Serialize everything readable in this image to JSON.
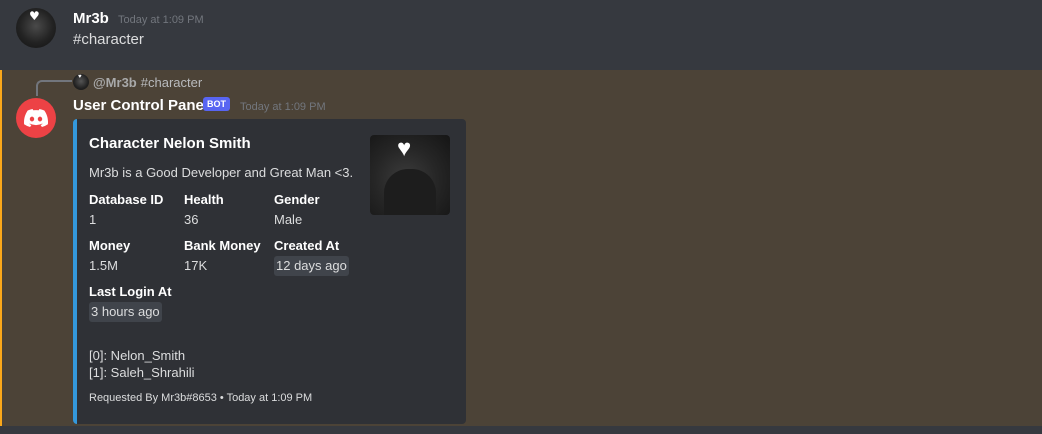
{
  "message1": {
    "username": "Mr3b",
    "timestamp": "Today at 1:09 PM",
    "content": "#character"
  },
  "message2": {
    "reply": {
      "mention": "@Mr3b",
      "content": "#character"
    },
    "username": "User Control Panel",
    "bot_badge": "BOT",
    "timestamp": "Today at 1:09 PM",
    "embed": {
      "accent_color": "#3498db",
      "title": "Character Nelon Smith",
      "description": "Mr3b is a Good Developer and Great Man <3.",
      "fields": [
        {
          "name": "Database ID",
          "value": "1"
        },
        {
          "name": "Health",
          "value": "36"
        },
        {
          "name": "Gender",
          "value": "Male"
        },
        {
          "name": "Money",
          "value": "1.5M"
        },
        {
          "name": "Bank Money",
          "value": "17K"
        },
        {
          "name": "Created At",
          "value": "12 days ago"
        },
        {
          "name": "Last Login At",
          "value": "3 hours ago"
        }
      ],
      "list": [
        "[0]: Nelon_Smith",
        "[1]: Saleh_Shrahili"
      ],
      "footer": "Requested By Mr3b#8653 • Today at 1:09 PM"
    }
  },
  "colors": {
    "background": "#36393f",
    "highlight": "#4c4337",
    "mention_bar": "#faa81a",
    "bot_badge": "#5865f2",
    "bot_avatar": "#ed4245"
  },
  "icons": {
    "bot_avatar": "discord-logo-icon",
    "user_avatar": "avatar-heart-icon"
  }
}
